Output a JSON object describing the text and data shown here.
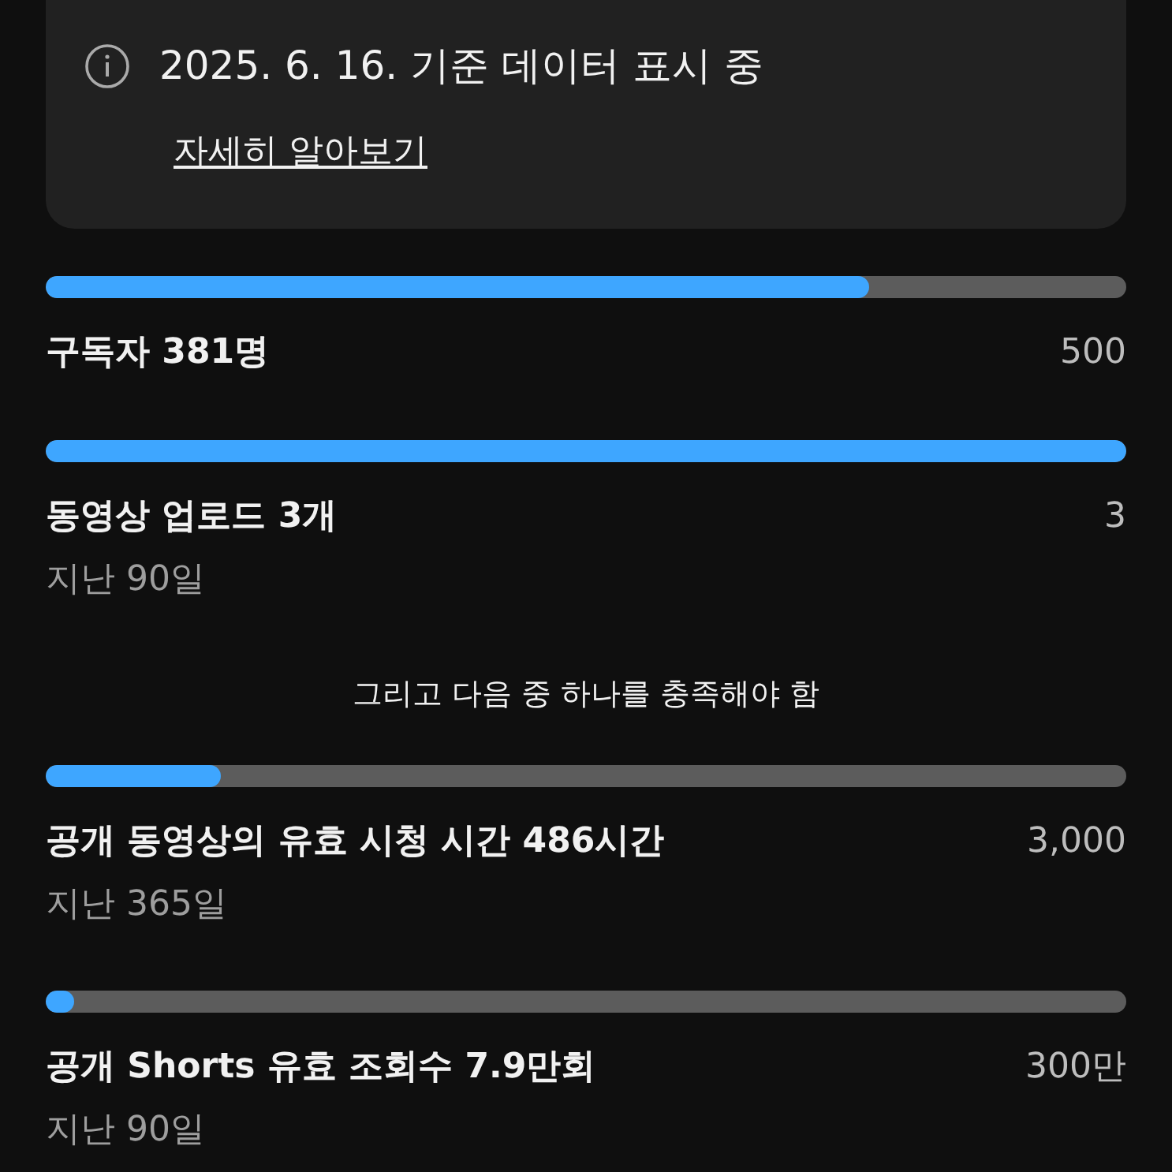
{
  "info_card": {
    "title": "2025. 6. 16. 기준 데이터 표시 중",
    "link": "자세히 알아보기"
  },
  "items": [
    {
      "kind": "progress",
      "label": "구독자 381명",
      "target": "500",
      "level": 0.762
    },
    {
      "kind": "progress",
      "label": "동영상 업로드 3개",
      "target": "3",
      "period": "지난 90일",
      "level": 1
    },
    {
      "kind": "note",
      "text": "그리고 다음 중 하나를 충족해야 함"
    },
    {
      "kind": "progress",
      "label": "공개 동영상의 유효 시청 시간 486시간",
      "target": "3,000",
      "period": "지난 365일",
      "level": 0.162
    },
    {
      "kind": "progress",
      "label": "공개 Shorts 유효 조회수 7.9만회",
      "target": "300만",
      "period": "지난 90일",
      "level": 0.026
    }
  ]
}
